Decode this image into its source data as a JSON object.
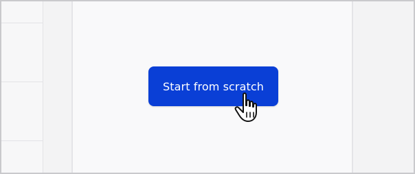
{
  "main": {
    "cta_label": "Start from scratch",
    "cta_color": "#0a3fd6"
  },
  "icons": {
    "cursor": "hand-pointer-icon"
  }
}
